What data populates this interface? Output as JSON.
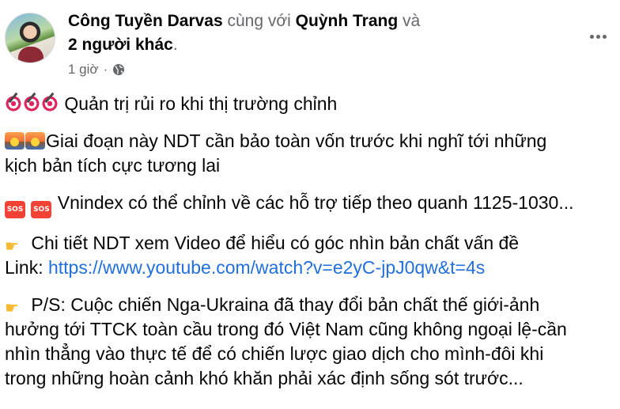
{
  "post": {
    "author": "Công Tuyền Darvas",
    "with_text": "cùng với",
    "tagged": "Quỳnh Trang",
    "and_text": "và",
    "others": "2 người khác",
    "period": ".",
    "time": "1 giờ",
    "dot": "·"
  },
  "icons": {
    "avatar": "profile-photo",
    "audience": "globe-icon",
    "more": "more-horizontal-icon",
    "target": "direct-hit-emoji",
    "sunrise": "sunrise-emoji",
    "sos": "sos-emoji",
    "hand": "backhand-index-pointing-right-emoji"
  },
  "content": {
    "p1": "Quản trị rủi ro khi thị trường chỉnh",
    "p2_line1": "Giai đoạn này NDT cần bảo toàn vốn trước khi nghĩ tới những",
    "p2_line2": "kịch bản tích cực tương lai",
    "p3": "Vnindex có thể chỉnh về các hỗ trợ tiếp theo quanh 1125-1030...",
    "p4_line1": "Chi tiết NDT xem Video để hiểu có góc nhìn bản chất vấn đề",
    "p4_link_label": "Link:",
    "p4_link": "https://www.youtube.com/watch?v=e2yC-jpJ0qw&t=4s",
    "p5_line1": "P/S: Cuộc chiến Nga-Ukraina đã thay đổi bản chất thế giới-ảnh",
    "p5_line2": "hưởng tới TTCK toàn cầu trong đó Việt Nam cũng không ngoại lệ-cần",
    "p5_line3": "nhìn thẳng vào thực tế để có chiến lược giao dịch cho mình-đôi khi",
    "p5_line4": "trong những hoàn cảnh khó khăn phải xác định sống sót trước..."
  },
  "colors": {
    "link": "#216fdb",
    "muted": "#65676b",
    "text": "#050505"
  }
}
